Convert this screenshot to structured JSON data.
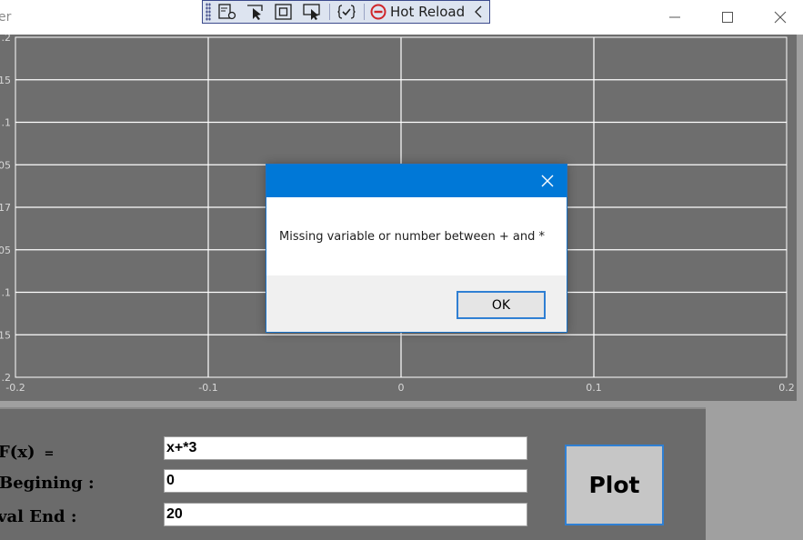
{
  "window": {
    "title": "er",
    "controls": [
      "minimize-icon",
      "maximize-icon",
      "close-icon"
    ]
  },
  "debug_toolbar": {
    "tools": [
      "live-visual-tree-icon",
      "select-element-icon",
      "display-layout-adorners-icon",
      "track-focused-element-icon",
      "binding-failures-icon"
    ],
    "hot_reload_label": "Hot Reload",
    "hot_reload_status": "stop-icon",
    "collapse_icon": "chevron-left-icon"
  },
  "chart": {
    "background": "#6e6e6e",
    "grid_color": "#ffffff",
    "y_tick_labels": [
      ".2",
      "15",
      ".1",
      "05",
      "17",
      "05",
      ".1",
      "15",
      ".2"
    ],
    "x_tick_labels": [
      "-0.2",
      "-0.1",
      "0",
      "0.1",
      "0.2"
    ]
  },
  "form": {
    "fx_label": "F(x)",
    "fx_equals": "=",
    "fx_value": "x+*3",
    "begin_label": "Begining :",
    "begin_value": "0",
    "end_label": "val End :",
    "end_value": "20",
    "plot_label": "Plot"
  },
  "dialog": {
    "message": "Missing variable or number between + and *",
    "ok_label": "OK",
    "accent": "#0078d7"
  }
}
